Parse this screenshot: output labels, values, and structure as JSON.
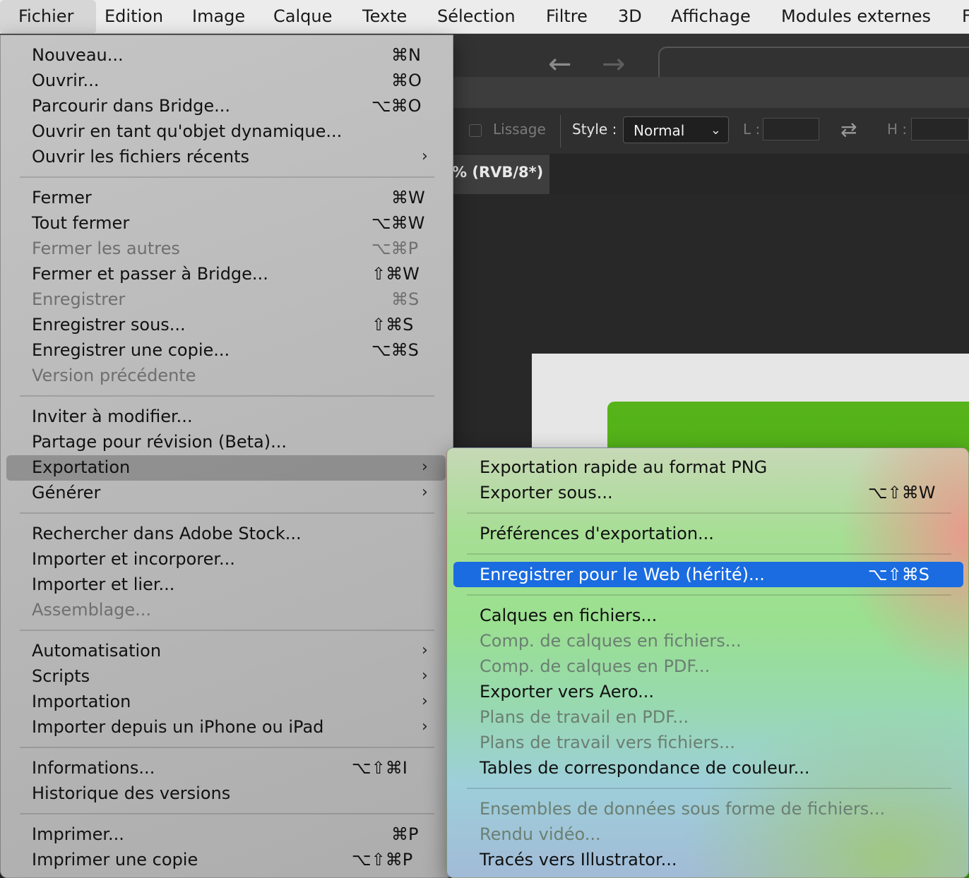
{
  "menubar": {
    "items": [
      "Fichier",
      "Edition",
      "Image",
      "Calque",
      "Texte",
      "Sélection",
      "Filtre",
      "3D",
      "Affichage",
      "Modules externes",
      "F"
    ]
  },
  "toolbar": {
    "lissage_label": "Lissage",
    "style_label": "Style :",
    "style_value": "Normal",
    "width_label": "L :",
    "height_label": "H :"
  },
  "document_tab": {
    "title_fragment": "% (RVB/8*)"
  },
  "file_menu": {
    "items": [
      {
        "label": "Nouveau...",
        "shortcut": "⌘N"
      },
      {
        "label": "Ouvrir...",
        "shortcut": "⌘O"
      },
      {
        "label": "Parcourir dans Bridge...",
        "shortcut": "⌥⌘O"
      },
      {
        "label": "Ouvrir en tant qu'objet dynamique...",
        "shortcut": ""
      },
      {
        "label": "Ouvrir les fichiers récents",
        "shortcut": ""
      },
      {
        "label": "Fermer",
        "shortcut": "⌘W"
      },
      {
        "label": "Tout fermer",
        "shortcut": "⌥⌘W"
      },
      {
        "label": "Fermer les autres",
        "shortcut": "⌥⌘P"
      },
      {
        "label": "Fermer et passer à Bridge...",
        "shortcut": "⇧⌘W"
      },
      {
        "label": "Enregistrer",
        "shortcut": "⌘S"
      },
      {
        "label": "Enregistrer sous...",
        "shortcut": "⇧⌘S"
      },
      {
        "label": "Enregistrer une copie...",
        "shortcut": "⌥⌘S"
      },
      {
        "label": "Version précédente",
        "shortcut": ""
      },
      {
        "label": "Inviter à modifier...",
        "shortcut": ""
      },
      {
        "label": "Partage pour révision (Beta)...",
        "shortcut": ""
      },
      {
        "label": "Exportation",
        "shortcut": ""
      },
      {
        "label": "Générer",
        "shortcut": ""
      },
      {
        "label": "Rechercher dans Adobe Stock...",
        "shortcut": ""
      },
      {
        "label": "Importer et incorporer...",
        "shortcut": ""
      },
      {
        "label": "Importer et lier...",
        "shortcut": ""
      },
      {
        "label": "Assemblage...",
        "shortcut": ""
      },
      {
        "label": "Automatisation",
        "shortcut": ""
      },
      {
        "label": "Scripts",
        "shortcut": ""
      },
      {
        "label": "Importation",
        "shortcut": ""
      },
      {
        "label": "Importer depuis un iPhone ou iPad",
        "shortcut": ""
      },
      {
        "label": "Informations...",
        "shortcut": "⌥⇧⌘I"
      },
      {
        "label": "Historique des versions",
        "shortcut": ""
      },
      {
        "label": "Imprimer...",
        "shortcut": "⌘P"
      },
      {
        "label": "Imprimer une copie",
        "shortcut": "⌥⇧⌘P"
      }
    ]
  },
  "export_submenu": {
    "items": [
      {
        "label": "Exportation rapide au format PNG",
        "shortcut": ""
      },
      {
        "label": "Exporter sous...",
        "shortcut": "⌥⇧⌘W"
      },
      {
        "label": "Préférences d'exportation...",
        "shortcut": ""
      },
      {
        "label": "Enregistrer pour le Web (hérité)...",
        "shortcut": "⌥⇧⌘S"
      },
      {
        "label": "Calques en fichiers...",
        "shortcut": ""
      },
      {
        "label": "Comp. de calques en fichiers...",
        "shortcut": ""
      },
      {
        "label": "Comp. de calques en PDF...",
        "shortcut": ""
      },
      {
        "label": "Exporter vers Aero...",
        "shortcut": ""
      },
      {
        "label": "Plans de travail en PDF...",
        "shortcut": ""
      },
      {
        "label": "Plans de travail vers fichiers...",
        "shortcut": ""
      },
      {
        "label": "Tables de correspondance de couleur...",
        "shortcut": ""
      },
      {
        "label": "Ensembles de données sous forme de fichiers...",
        "shortcut": ""
      },
      {
        "label": "Rendu vidéo...",
        "shortcut": ""
      },
      {
        "label": "Tracés vers Illustrator...",
        "shortcut": ""
      }
    ]
  },
  "icons": {
    "submenu_arrow": "›",
    "back_arrow": "←",
    "forward_arrow": "→",
    "swap": "⇄",
    "chevron_down": "⌄"
  },
  "colors": {
    "selection_blue": "#1a6ce0",
    "canvas_green": "#4aa614"
  }
}
